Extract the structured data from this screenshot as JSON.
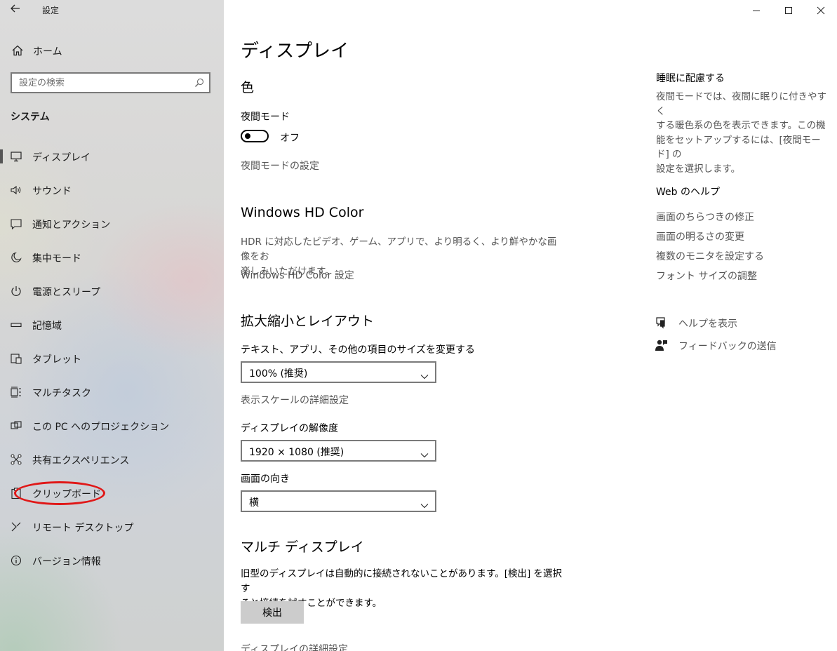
{
  "app": {
    "title": "設定",
    "back_icon": "back-arrow-icon"
  },
  "sidebar": {
    "home_label": "ホーム",
    "search_placeholder": "設定の検索",
    "section_heading": "システム",
    "items": [
      {
        "label": "ディスプレイ",
        "icon": "monitor-icon",
        "selected": true
      },
      {
        "label": "サウンド",
        "icon": "speaker-icon"
      },
      {
        "label": "通知とアクション",
        "icon": "notification-icon"
      },
      {
        "label": "集中モード",
        "icon": "moon-icon"
      },
      {
        "label": "電源とスリープ",
        "icon": "power-icon"
      },
      {
        "label": "記憶域",
        "icon": "storage-icon"
      },
      {
        "label": "タブレット",
        "icon": "tablet-icon"
      },
      {
        "label": "マルチタスク",
        "icon": "multitask-icon"
      },
      {
        "label": "この PC へのプロジェクション",
        "icon": "projection-icon"
      },
      {
        "label": "共有エクスペリエンス",
        "icon": "shared-experience-icon"
      },
      {
        "label": "クリップボード",
        "icon": "clipboard-icon"
      },
      {
        "label": "リモート デスクトップ",
        "icon": "remote-desktop-icon"
      },
      {
        "label": "バージョン情報",
        "icon": "info-icon"
      }
    ],
    "annotation_color": "#e01818"
  },
  "main": {
    "page_title": "ディスプレイ",
    "color": {
      "heading": "色",
      "night_light_label": "夜間モード",
      "toggle_state": "オフ",
      "night_light_settings_link": "夜間モードの設定"
    },
    "hdr": {
      "heading": "Windows HD Color",
      "description_line1": "HDR に対応したビデオ、ゲーム、アプリで、より明るく、より鮮やかな画像をお",
      "description_line2": "楽しみいただけます。",
      "settings_link": "Windows HD Color 設定"
    },
    "scale": {
      "heading": "拡大縮小とレイアウト",
      "size_label": "テキスト、アプリ、その他の項目のサイズを変更する",
      "size_value": "100% (推奨)",
      "advanced_scaling_link": "表示スケールの詳細設定",
      "resolution_label": "ディスプレイの解像度",
      "resolution_value": "1920 × 1080 (推奨)",
      "orientation_label": "画面の向き",
      "orientation_value": "横"
    },
    "multi": {
      "heading": "マルチ ディスプレイ",
      "description_line1": "旧型のディスプレイは自動的に接続されないことがあります。[検出] を選択す",
      "description_line2": "ると接続を試すことができます。",
      "detect_button": "検出",
      "advanced_display_link": "ディスプレイの詳細設定"
    }
  },
  "right_panel": {
    "sleep_heading": "睡眠に配慮する",
    "sleep_desc_lines": [
      "夜間モードでは、夜間に眠りに付きやすく",
      "する暖色系の色を表示できます。この機",
      "能をセットアップするには、[夜間モード] の",
      "設定を選択します。"
    ],
    "web_help_heading": "Web のヘルプ",
    "web_links": [
      "画面のちらつきの修正",
      "画面の明るさの変更",
      "複数のモニタを設定する",
      "フォント サイズの調整"
    ],
    "get_help": "ヘルプを表示",
    "feedback": "フィードバックの送信"
  },
  "window_controls": {
    "minimize_icon": "minimize-icon",
    "maximize_icon": "maximize-icon",
    "close_icon": "close-icon"
  }
}
